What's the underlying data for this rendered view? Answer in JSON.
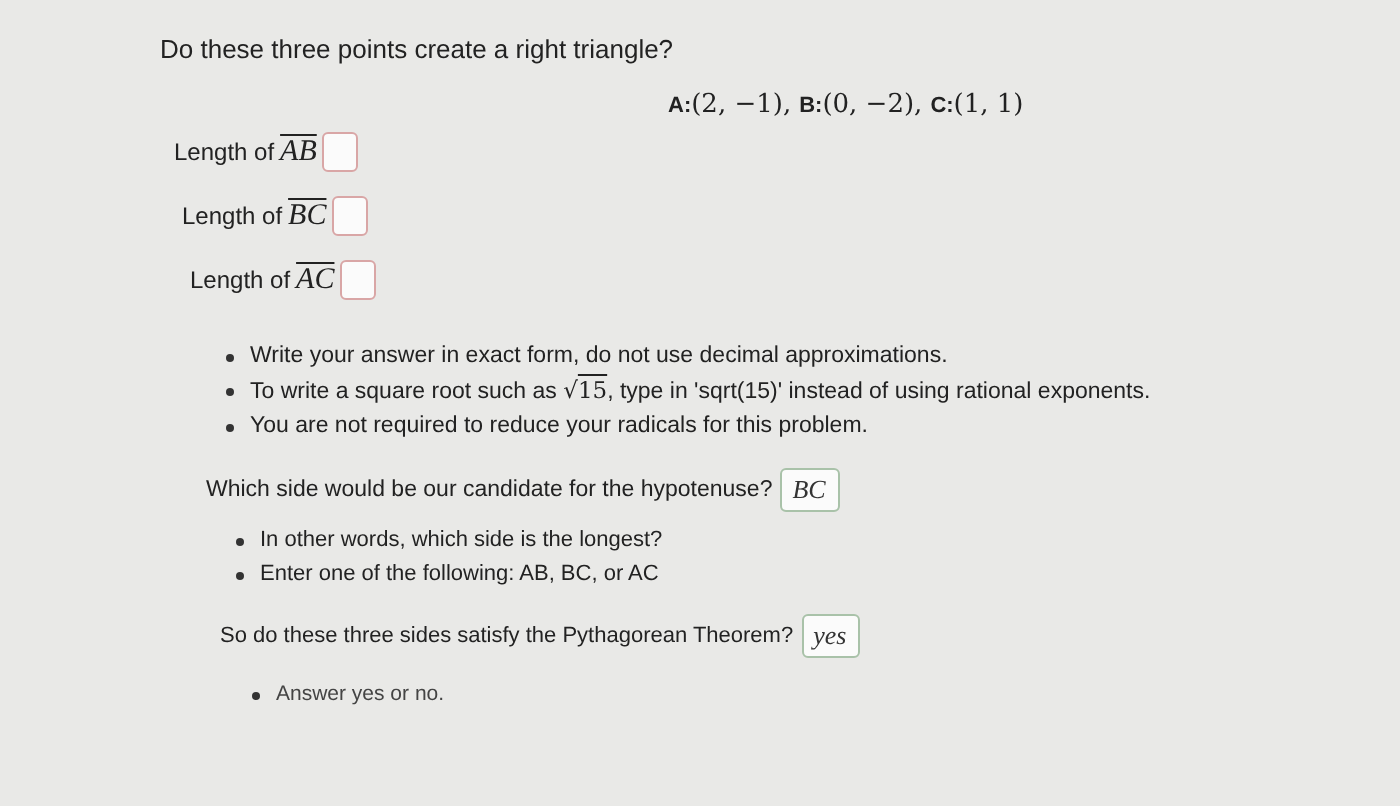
{
  "question": "Do these three points create a right triangle?",
  "points": [
    {
      "label": "A:",
      "coords": "(2, −1),"
    },
    {
      "label": "B:",
      "coords": "(0, −2),"
    },
    {
      "label": "C:",
      "coords": "(1, 1)"
    }
  ],
  "length_rows": [
    {
      "label": "Length of",
      "segment": "AB",
      "value": "",
      "answered": false
    },
    {
      "label": "Length of",
      "segment": "BC",
      "value": "",
      "answered": false
    },
    {
      "label": "Length of",
      "segment": "AC",
      "value": "",
      "answered": false
    }
  ],
  "instructions": [
    {
      "kind": "text",
      "text": "Write your answer in exact form, do not use decimal approximations."
    },
    {
      "kind": "radical",
      "before": "To write a square root such as",
      "radical": "√",
      "radicand": "15",
      "after": ", type in 'sqrt(15)' instead of using rational exponents."
    },
    {
      "kind": "text",
      "text": "You are not required to reduce your radicals for this problem."
    }
  ],
  "hypotenuse": {
    "prompt": "Which side would be our candidate for the hypotenuse?",
    "value": "BC",
    "answered": true,
    "hints": [
      "In other words, which side is the longest?",
      "Enter one of the following: AB, BC, or AC"
    ]
  },
  "pythagorean": {
    "prompt": "So do these three sides satisfy the Pythagorean Theorem?",
    "value": "yes",
    "answered": true,
    "hints": [
      "Answer yes or no."
    ]
  }
}
